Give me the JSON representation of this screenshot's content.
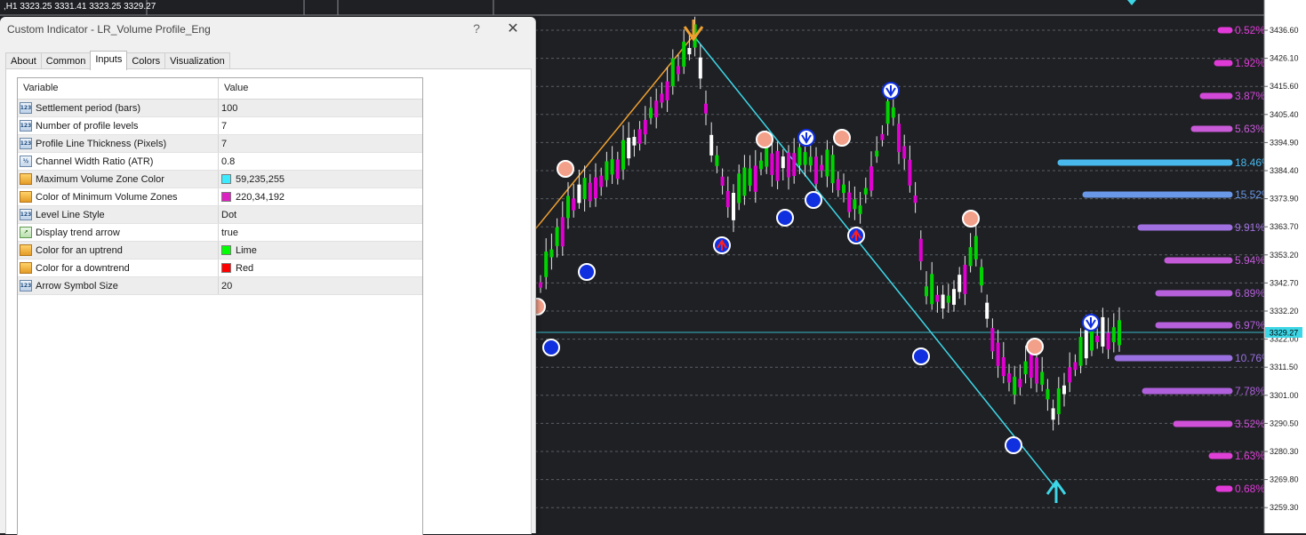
{
  "chart_header": {
    "ohlc_text": ",H1  3323.25 3331.41 3323.25 3329.27"
  },
  "price_scale": {
    "labels": [
      "3436.60",
      "3426.10",
      "3415.60",
      "3405.40",
      "3394.90",
      "3384.40",
      "3373.90",
      "3363.70",
      "3353.20",
      "3342.70",
      "3332.20",
      "3322.00",
      "3311.50",
      "3301.00",
      "3290.50",
      "3280.30",
      "3269.80",
      "3259.30"
    ],
    "current_price": "3329.27",
    "colors": {
      "background": "#1e2024",
      "grid": "#5a5d63",
      "uptrend": "#00d400",
      "downtrend": "#e000d0",
      "line_up": "#f0a030",
      "line_down": "#3dd6e6",
      "bid_line": "#3dd6e6"
    }
  },
  "volume_profile": {
    "levels": [
      {
        "pct": "0.52%",
        "color": "#e23ad8"
      },
      {
        "pct": "1.92%",
        "color": "#e03ad6"
      },
      {
        "pct": "3.87%",
        "color": "#d248d8"
      },
      {
        "pct": "5.63%",
        "color": "#c95ad8"
      },
      {
        "pct": "",
        "color": "#c060d8"
      },
      {
        "pct": "18.46%",
        "color": "#48b8ec"
      },
      {
        "pct": "15.52%",
        "color": "#6a98e8"
      },
      {
        "pct": "9.91%",
        "color": "#a070e0"
      },
      {
        "pct": "5.94%",
        "color": "#c45ad8"
      },
      {
        "pct": "6.89%",
        "color": "#b660dc"
      },
      {
        "pct": "6.97%",
        "color": "#b660dc"
      },
      {
        "pct": "10.76%",
        "color": "#9a70e0"
      },
      {
        "pct": "7.78%",
        "color": "#b060dc"
      },
      {
        "pct": "3.52%",
        "color": "#d050d8"
      },
      {
        "pct": "1.63%",
        "color": "#e040d6"
      },
      {
        "pct": "0.68%",
        "color": "#e23ad8"
      }
    ]
  },
  "dialog": {
    "title": "Custom Indicator - LR_Volume Profile_Eng",
    "help_label": "?",
    "close_label": "✕",
    "tabs": [
      "About",
      "Common",
      "Inputs",
      "Colors",
      "Visualization"
    ],
    "active_tab": "Inputs",
    "columns": {
      "variable": "Variable",
      "value": "Value"
    },
    "rows": [
      {
        "label": "Settlement period (bars)",
        "value": "100",
        "icon": "123"
      },
      {
        "label": "Number of profile levels",
        "value": "7",
        "icon": "123"
      },
      {
        "label": "Profile Line Thickness (Pixels)",
        "value": "7",
        "icon": "123"
      },
      {
        "label": "Channel Width Ratio (ATR)",
        "value": "0.8",
        "icon": "1/2"
      },
      {
        "label": "Maximum Volume Zone Color",
        "value": "59,235,255",
        "icon": "color",
        "swatch": "#3bebff"
      },
      {
        "label": "Color of Minimum Volume Zones",
        "value": "220,34,192",
        "icon": "color",
        "swatch": "#dc22c0"
      },
      {
        "label": "Level Line Style",
        "value": "Dot",
        "icon": "123"
      },
      {
        "label": "Display trend arrow",
        "value": "true",
        "icon": "arrow"
      },
      {
        "label": "Color for an uptrend",
        "value": "Lime",
        "icon": "color",
        "swatch": "#00ff00"
      },
      {
        "label": "Color for a downtrend",
        "value": "Red",
        "icon": "color",
        "swatch": "#ff0000"
      },
      {
        "label": "Arrow Symbol Size",
        "value": "20",
        "icon": "123"
      }
    ]
  }
}
